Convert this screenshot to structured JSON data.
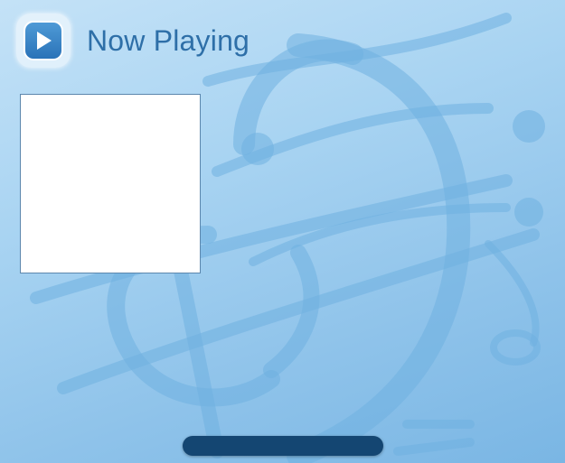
{
  "header": {
    "title": "Now Playing",
    "play_button_icon": "play-icon"
  },
  "now_playing": {
    "album_art": "blank"
  },
  "colors": {
    "title": "#2e6fa8",
    "accent": "#2a73b8",
    "bar": "#144672",
    "background": "#a9d4f2"
  }
}
